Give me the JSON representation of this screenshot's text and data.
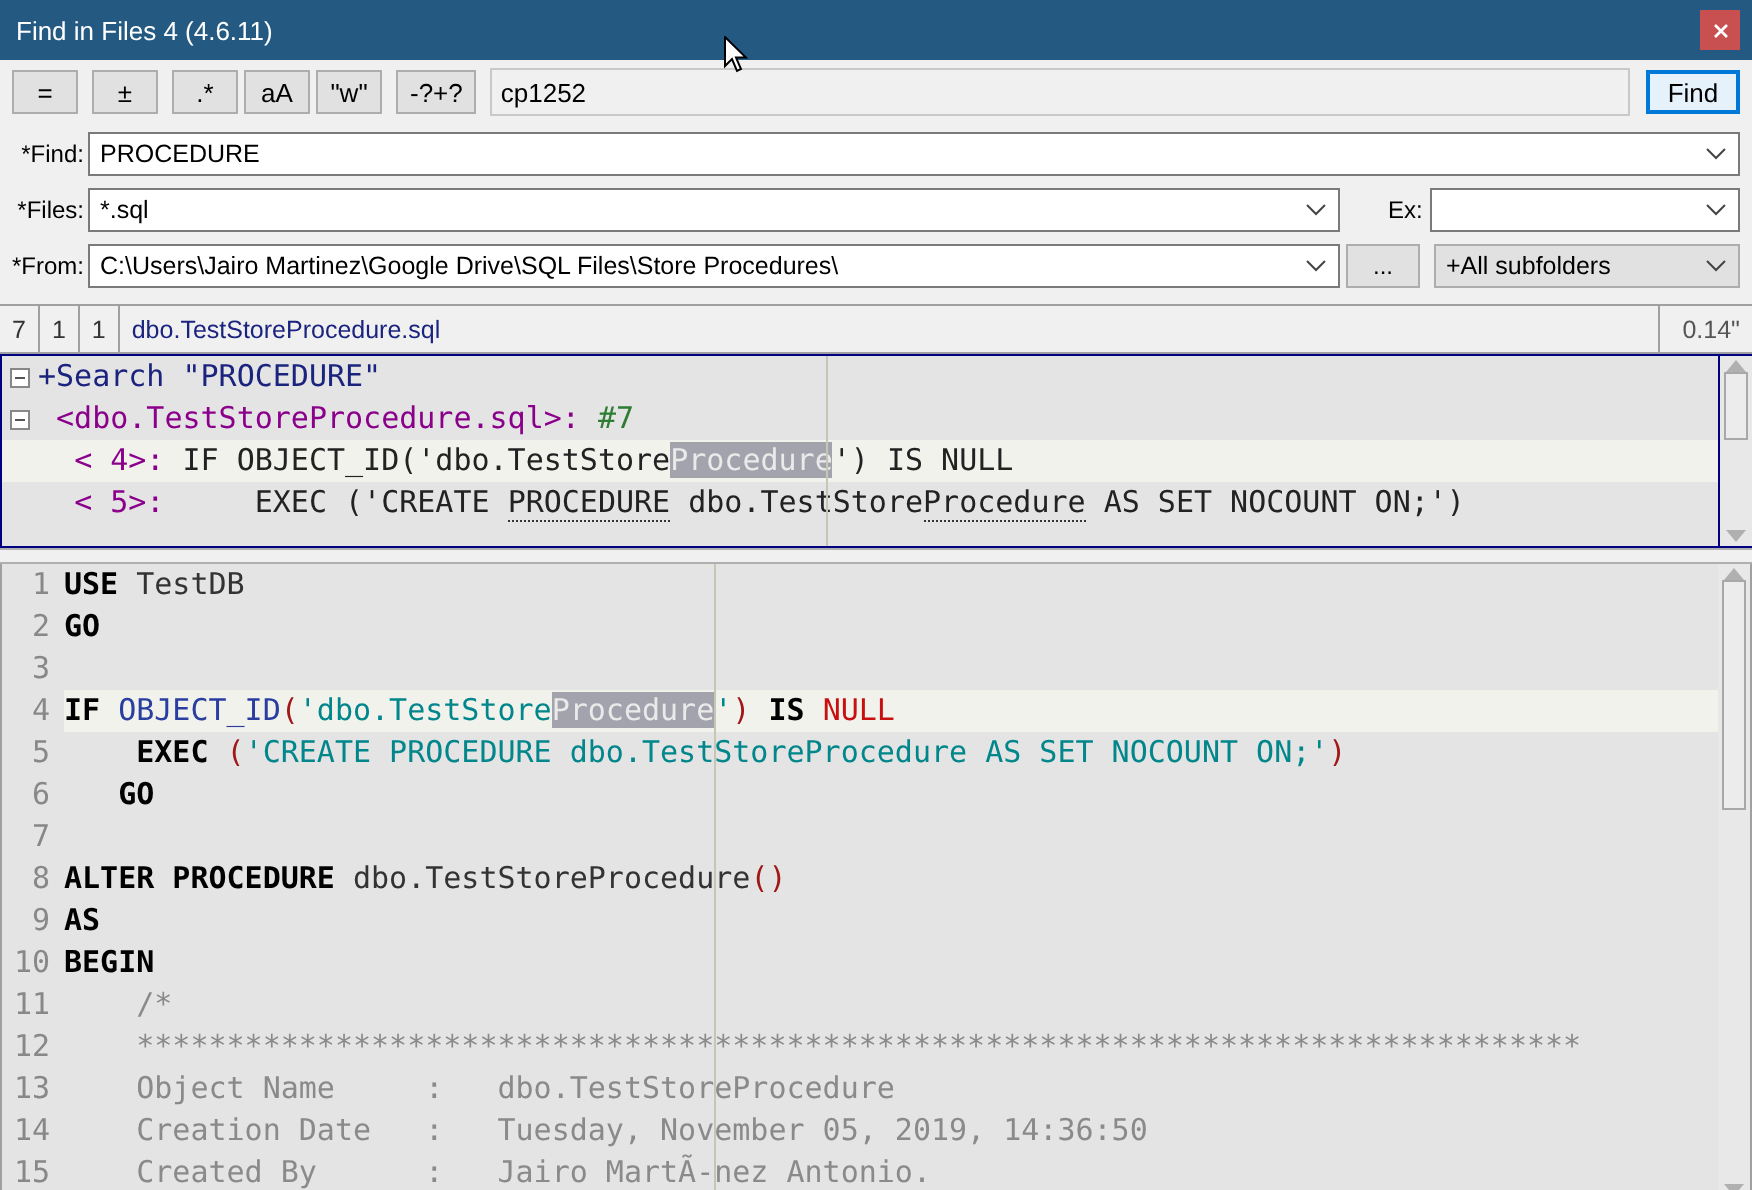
{
  "window": {
    "title": "Find in Files 4 (4.6.11)"
  },
  "toolbar": {
    "buttons": [
      "=",
      "±",
      ".*",
      "aA",
      "\"w\"",
      "-?+?"
    ],
    "encoding": "cp1252",
    "find_button": "Find"
  },
  "form": {
    "find": {
      "label": "*Find:",
      "value": "PROCEDURE"
    },
    "files": {
      "label": "*Files:",
      "value": "*.sql"
    },
    "exclude": {
      "label": "Ex:"
    },
    "from": {
      "label": "*From:",
      "value": "C:\\Users\\Jairo Martinez\\Google Drive\\SQL Files\\Store Procedures\\"
    },
    "browse_button": "...",
    "subfolders": "+All subfolders"
  },
  "status_bar": {
    "cells": [
      "7",
      "1",
      "1"
    ],
    "file": "dbo.TestStoreProcedure.sql",
    "time": "0.14\""
  },
  "results": [
    {
      "kind": "header",
      "text": "+Search \"PROCEDURE\"",
      "current": false
    },
    {
      "kind": "file",
      "text": "<dbo.TestStoreProcedure.sql>:",
      "count": " #7",
      "current": false
    },
    {
      "kind": "hit",
      "ref": "< 4>:",
      "current": true,
      "tokens": [
        {
          "kind": "text",
          "text": " IF OBJECT_ID('dbo.TestStore"
        },
        {
          "kind": "match",
          "text": "Procedure"
        },
        {
          "kind": "text",
          "text": "') IS NULL"
        }
      ]
    },
    {
      "kind": "hit",
      "ref": "< 5>:",
      "current": false,
      "tokens": [
        {
          "kind": "text",
          "text": "     EXEC ('CREATE "
        },
        {
          "kind": "marked",
          "text": "PROCEDURE"
        },
        {
          "kind": "text",
          "text": " dbo.TestStore"
        },
        {
          "kind": "marked",
          "text": "Procedure"
        },
        {
          "kind": "text",
          "text": " AS SET NOCOUNT ON;')"
        }
      ]
    }
  ],
  "editor": {
    "lines": [
      {
        "number": "1",
        "current": false,
        "tokens": [
          {
            "kind": "keyword",
            "text": "USE"
          },
          {
            "kind": "text",
            "text": " TestDB"
          }
        ]
      },
      {
        "number": "2",
        "current": false,
        "tokens": [
          {
            "kind": "keyword",
            "text": "GO"
          }
        ]
      },
      {
        "number": "3",
        "current": false
      },
      {
        "number": "4",
        "current": true,
        "tokens": [
          {
            "kind": "keyword",
            "text": "IF "
          },
          {
            "kind": "function",
            "text": "OBJECT_ID"
          },
          {
            "kind": "paren",
            "text": "("
          },
          {
            "kind": "string",
            "text": "'dbo.TestStore"
          },
          {
            "kind": "match",
            "text": "Procedure"
          },
          {
            "kind": "string",
            "text": "'"
          },
          {
            "kind": "paren",
            "text": ") "
          },
          {
            "kind": "keyword",
            "text": "IS "
          },
          {
            "kind": "null",
            "text": "NULL"
          }
        ]
      },
      {
        "number": "5",
        "current": false,
        "tokens": [
          {
            "kind": "keyword",
            "text": "    EXEC "
          },
          {
            "kind": "paren",
            "text": "("
          },
          {
            "kind": "string",
            "text": "'CREATE PROCEDURE dbo.TestStoreProcedure AS SET NOCOUNT ON;'"
          },
          {
            "kind": "paren",
            "text": ")"
          }
        ]
      },
      {
        "number": "6",
        "current": false,
        "tokens": [
          {
            "kind": "keyword",
            "text": "   GO"
          }
        ]
      },
      {
        "number": "7",
        "current": false
      },
      {
        "number": "8",
        "current": false,
        "tokens": [
          {
            "kind": "keyword",
            "text": "ALTER PROCEDURE"
          },
          {
            "kind": "text",
            "text": " dbo.TestStoreProcedure"
          },
          {
            "kind": "paren",
            "text": "()"
          }
        ]
      },
      {
        "number": "9",
        "current": false,
        "tokens": [
          {
            "kind": "keyword",
            "text": "AS"
          }
        ]
      },
      {
        "number": "10",
        "current": false,
        "tokens": [
          {
            "kind": "keyword",
            "text": "BEGIN"
          }
        ]
      },
      {
        "number": "11",
        "current": false,
        "tokens": [
          {
            "kind": "comment",
            "text": "    /*"
          }
        ]
      },
      {
        "number": "12",
        "current": false,
        "tokens": [
          {
            "kind": "comment",
            "text": "    ********************************************************************************"
          }
        ]
      },
      {
        "number": "13",
        "current": false,
        "tokens": [
          {
            "kind": "comment",
            "text": "    Object Name     :   dbo.TestStoreProcedure"
          }
        ]
      },
      {
        "number": "14",
        "current": false,
        "tokens": [
          {
            "kind": "comment",
            "text": "    Creation Date   :   Tuesday, November 05, 2019, 14:36:50"
          }
        ]
      },
      {
        "number": "15",
        "current": false,
        "tokens": [
          {
            "kind": "comment",
            "text": "    Created By      :   Jairo MartÃ-nez Antonio."
          }
        ]
      }
    ]
  }
}
